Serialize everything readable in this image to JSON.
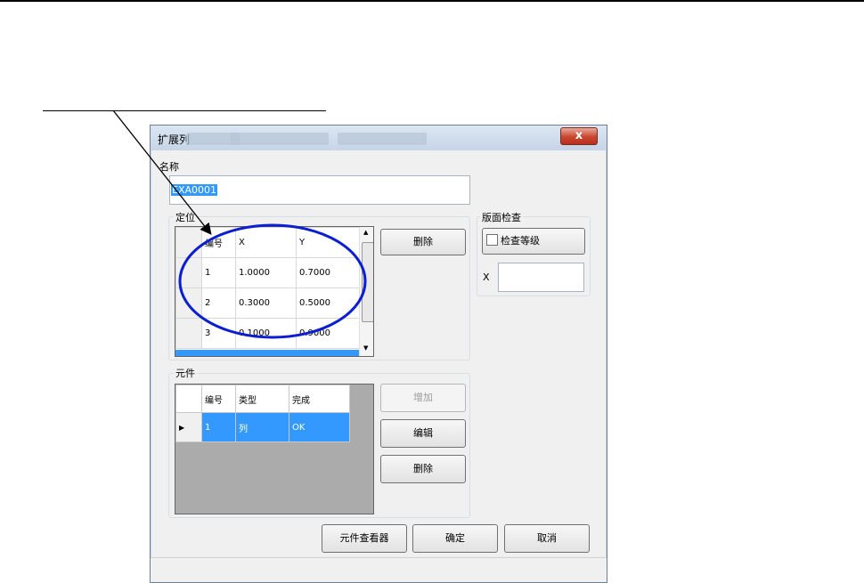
{
  "window": {
    "title": "扩展列",
    "close_symbol": "x",
    "ghost_text": [
      "",
      "",
      ""
    ]
  },
  "name_section": {
    "label": "名称",
    "value": "EXA0001"
  },
  "positioning": {
    "group_title": "定位",
    "columns": [
      "编号",
      "X",
      "Y"
    ],
    "rows": [
      {
        "no": "1",
        "x": "1.0000",
        "y": "0.7000"
      },
      {
        "no": "2",
        "x": "0.3000",
        "y": "0.5000"
      },
      {
        "no": "3",
        "x": "0.1000",
        "y": "0.9000"
      }
    ],
    "delete_label": "删除",
    "scroll_up": "▲",
    "scroll_down": "▼"
  },
  "page_check": {
    "group_title": "版面检查",
    "checkbox_label": "检查等级",
    "x_label": "X",
    "x_value": ""
  },
  "components": {
    "group_title": "元件",
    "columns": [
      "编号",
      "类型",
      "完成"
    ],
    "rows": [
      {
        "no": "1",
        "type": "列",
        "done": "OK"
      }
    ],
    "row_marker": "▶",
    "add_label": "增加",
    "edit_label": "编辑",
    "delete_label": "删除"
  },
  "footer": {
    "viewer_label": "元件查看器",
    "ok_label": "确定",
    "cancel_label": "取消"
  },
  "colors": {
    "selection": "#3399ff",
    "annotation_ellipse": "#0b1fd1",
    "window_border": "#6f7e93"
  }
}
